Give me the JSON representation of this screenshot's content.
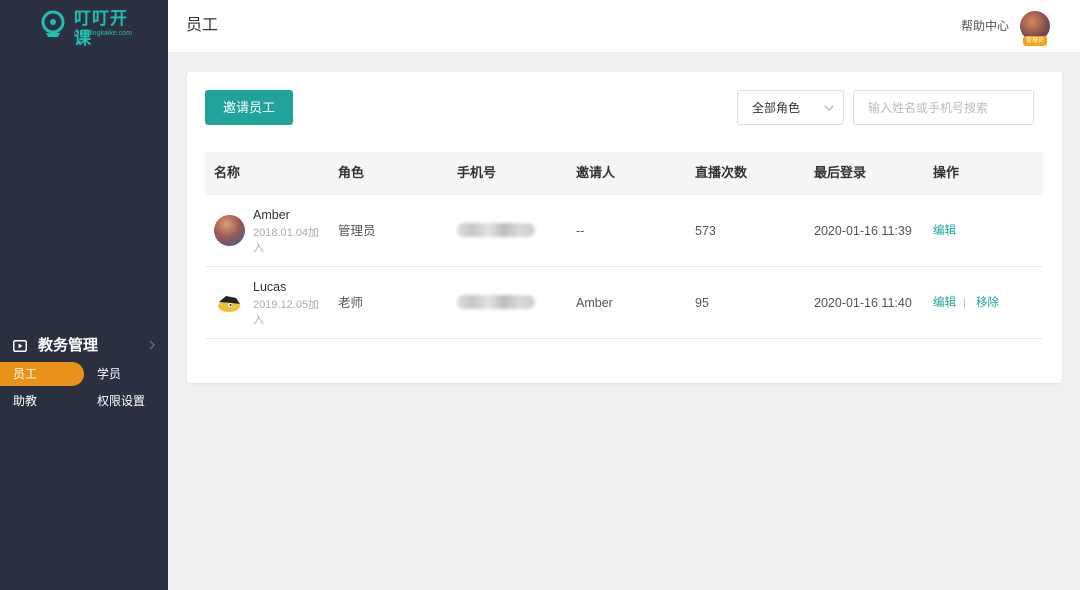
{
  "app": {
    "brand": "叮叮开课",
    "domain": "dingdingkaike.com"
  },
  "colors": {
    "sidebar_bg": "#2b3040",
    "accent": "#1fa39a",
    "active_menu": "#e8921a",
    "badge": "#f2a516"
  },
  "sidebar": {
    "group": {
      "icon": "play-square-icon",
      "label": "教务管理"
    },
    "items": [
      {
        "label": "员工",
        "active": true
      },
      {
        "label": "学员",
        "active": false
      },
      {
        "label": "助教",
        "active": false
      },
      {
        "label": "权限设置",
        "active": false
      }
    ]
  },
  "header": {
    "title": "员工",
    "help": "帮助中心",
    "badge": "管理员"
  },
  "toolbar": {
    "invite_label": "邀请员工",
    "role_filter": "全部角色",
    "search_placeholder": "输入姓名或手机号搜索"
  },
  "table": {
    "columns": [
      "名称",
      "角色",
      "手机号",
      "邀请人",
      "直播次数",
      "最后登录",
      "操作"
    ],
    "rows": [
      {
        "name": "Amber",
        "joined": "2018.01.04加入",
        "role": "管理员",
        "inviter": "--",
        "live_count": "573",
        "last_login": "2020-01-16 11:39",
        "actions": [
          "编辑"
        ]
      },
      {
        "name": "Lucas",
        "joined": "2019.12.05加入",
        "role": "老师",
        "inviter": "Amber",
        "live_count": "95",
        "last_login": "2020-01-16 11:40",
        "actions": [
          "编辑",
          "移除"
        ]
      }
    ]
  }
}
